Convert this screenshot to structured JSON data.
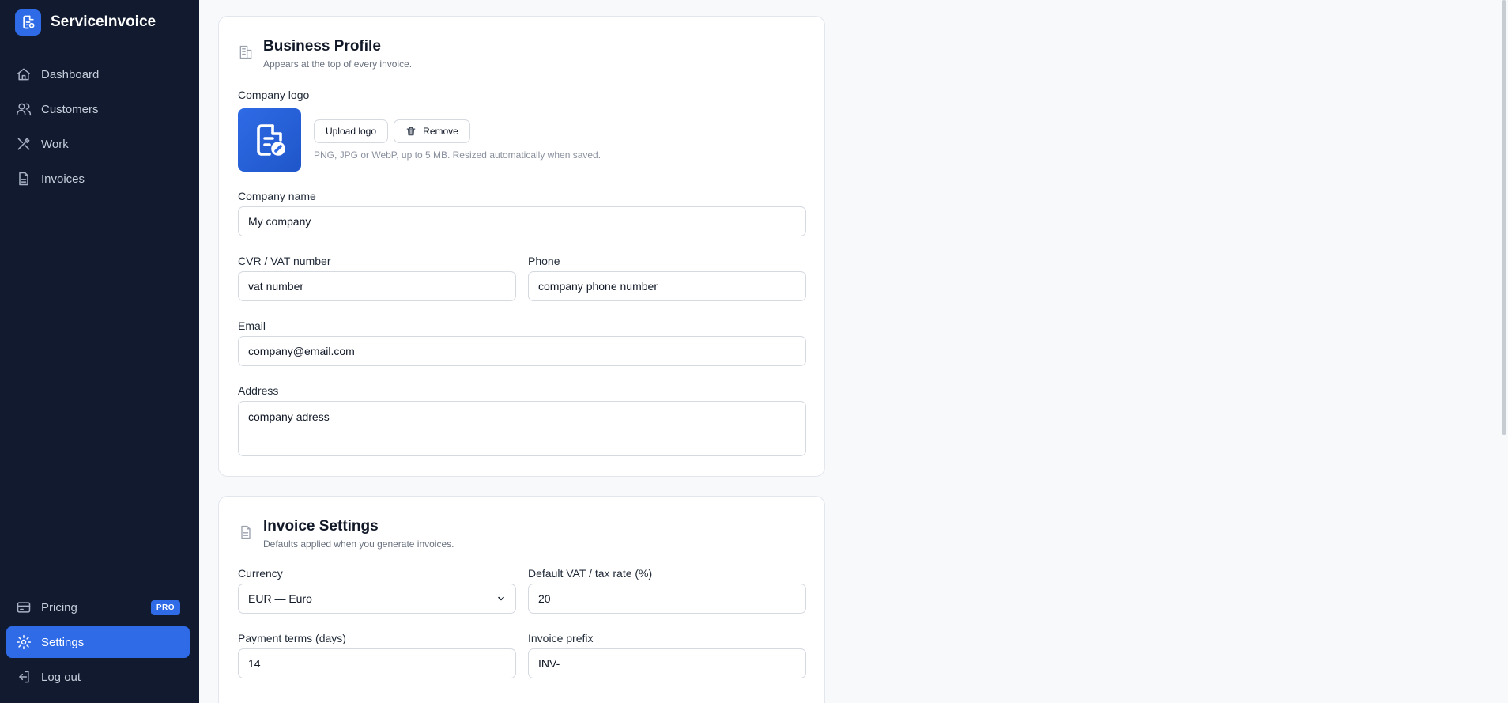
{
  "app": {
    "name": "ServiceInvoice"
  },
  "nav": {
    "items": [
      {
        "label": "Dashboard",
        "icon": "home-icon"
      },
      {
        "label": "Customers",
        "icon": "users-icon"
      },
      {
        "label": "Work",
        "icon": "tools-icon"
      },
      {
        "label": "Invoices",
        "icon": "file-icon"
      }
    ],
    "bottom": [
      {
        "label": "Pricing",
        "icon": "card-icon",
        "badge": "PRO"
      },
      {
        "label": "Settings",
        "icon": "gear-icon",
        "active": true
      },
      {
        "label": "Log out",
        "icon": "logout-icon"
      }
    ]
  },
  "business_profile": {
    "title": "Business Profile",
    "subtitle": "Appears at the top of every invoice.",
    "logo_label": "Company logo",
    "upload_button": "Upload logo",
    "remove_button": "Remove",
    "logo_hint": "PNG, JPG or WebP, up to 5 MB. Resized automatically when saved.",
    "company_name_label": "Company name",
    "company_name_value": "My company",
    "vat_label": "CVR / VAT number",
    "vat_value": "vat number",
    "phone_label": "Phone",
    "phone_value": "company phone number",
    "email_label": "Email",
    "email_value": "company@email.com",
    "address_label": "Address",
    "address_value": "company adress"
  },
  "invoice_settings": {
    "title": "Invoice Settings",
    "subtitle": "Defaults applied when you generate invoices.",
    "currency_label": "Currency",
    "currency_value": "EUR — Euro",
    "vat_rate_label": "Default VAT / tax rate (%)",
    "vat_rate_value": "20",
    "payment_terms_label": "Payment terms (days)",
    "payment_terms_value": "14",
    "prefix_label": "Invoice prefix",
    "prefix_value": "INV-"
  },
  "colors": {
    "sidebar": "#111a2e",
    "accent": "#2f6be6",
    "background": "#f8f9fb"
  }
}
